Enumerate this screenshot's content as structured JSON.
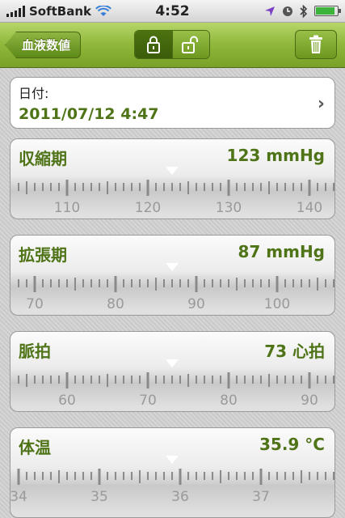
{
  "status_bar": {
    "carrier": "SoftBank",
    "time": "4:52",
    "battery_level": 0.9
  },
  "nav": {
    "back_label": "血液数値",
    "lock_active": "locked"
  },
  "date": {
    "label": "日付:",
    "value": "2011/07/12 4:47"
  },
  "panels": [
    {
      "label": "収縮期",
      "value": "123 mmHg",
      "ticks": [
        {
          "v": 110,
          "text": "110"
        },
        {
          "v": 120,
          "text": "120"
        },
        {
          "v": 130,
          "text": "130"
        },
        {
          "v": 140,
          "text": "140"
        }
      ],
      "current": 123,
      "step": 1
    },
    {
      "label": "拡張期",
      "value": "87 mmHg",
      "ticks": [
        {
          "v": 70,
          "text": "70"
        },
        {
          "v": 80,
          "text": "80"
        },
        {
          "v": 90,
          "text": "90"
        },
        {
          "v": 100,
          "text": "100"
        }
      ],
      "current": 87,
      "step": 1
    },
    {
      "label": "脈拍",
      "value": "73 心拍",
      "ticks": [
        {
          "v": 60,
          "text": "60"
        },
        {
          "v": 70,
          "text": "70"
        },
        {
          "v": 80,
          "text": "80"
        },
        {
          "v": 90,
          "text": "90"
        }
      ],
      "current": 73,
      "step": 1
    },
    {
      "label": "体温",
      "value": "35.9 °C",
      "ticks": [
        {
          "v": 34,
          "text": "34"
        },
        {
          "v": 35,
          "text": "35"
        },
        {
          "v": 36,
          "text": "36"
        },
        {
          "v": 37,
          "text": "37"
        }
      ],
      "current": 35.9,
      "step": 0.1
    }
  ],
  "colors": {
    "accent": "#4f7418",
    "nav": "#8fb73a"
  }
}
